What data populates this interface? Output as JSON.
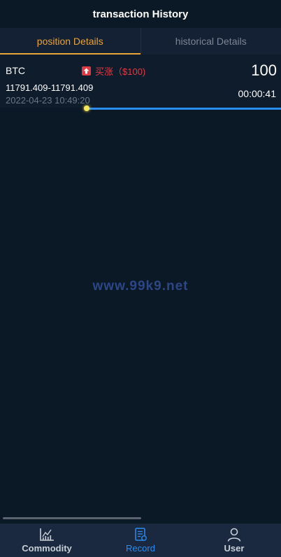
{
  "header": {
    "title": "transaction History"
  },
  "tabs": [
    {
      "label": "position Details",
      "active": true
    },
    {
      "label": "historical Details",
      "active": false
    }
  ],
  "position": {
    "symbol": "BTC",
    "direction_label": "买涨（$100)",
    "direction_icon": "arrow-up-icon",
    "amount": "100",
    "price_range": "11791.409-11791.409",
    "timer": "00:00:41",
    "datetime": "2022-04-23 10:49:20",
    "progress": 1.0
  },
  "watermark": "www.99k9.net",
  "bottom_nav": [
    {
      "label": "Commodity",
      "icon": "chart-icon",
      "active": false
    },
    {
      "label": "Record",
      "icon": "record-icon",
      "active": true
    },
    {
      "label": "User",
      "icon": "user-icon",
      "active": false
    }
  ],
  "colors": {
    "background": "#0b1826",
    "accent_tab": "#e9a43a",
    "accent_nav": "#2a8ef0",
    "buy_up": "#e23a44"
  }
}
